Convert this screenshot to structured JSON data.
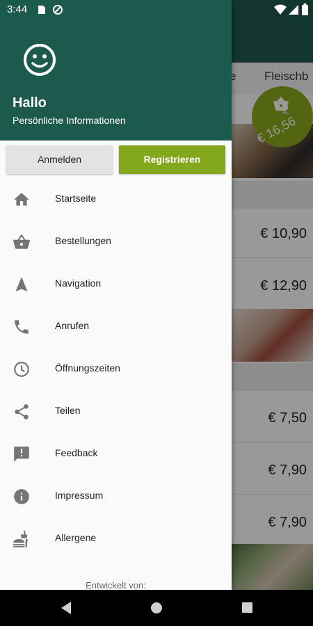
{
  "status_bar": {
    "time": "3:44"
  },
  "background": {
    "tabs": [
      "e",
      "Fleischb"
    ],
    "prices": [
      "€ 10,90",
      "€ 12,90",
      "€ 7,50",
      "€ 7,90",
      "€ 7,90"
    ],
    "cart": {
      "count": "2",
      "total": "€ 16,56"
    }
  },
  "drawer": {
    "header": {
      "greeting": "Hallo",
      "subtitle": "Persönliche Informationen"
    },
    "buttons": {
      "login": "Anmelden",
      "register": "Registrieren"
    },
    "items": [
      {
        "label": "Startseite",
        "icon": "home-icon"
      },
      {
        "label": "Bestellungen",
        "icon": "basket-icon"
      },
      {
        "label": "Navigation",
        "icon": "navigation-icon"
      },
      {
        "label": "Anrufen",
        "icon": "phone-icon"
      },
      {
        "label": "Öffnungszeiten",
        "icon": "clock-icon"
      },
      {
        "label": "Teilen",
        "icon": "share-icon"
      },
      {
        "label": "Feedback",
        "icon": "feedback-icon"
      },
      {
        "label": "Impressum",
        "icon": "info-icon"
      },
      {
        "label": "Allergene",
        "icon": "fastfood-icon"
      }
    ],
    "footer": "Entwickelt von:"
  },
  "colors": {
    "header": "#1d5a4e",
    "accent": "#84a81b",
    "icon": "#757575"
  }
}
